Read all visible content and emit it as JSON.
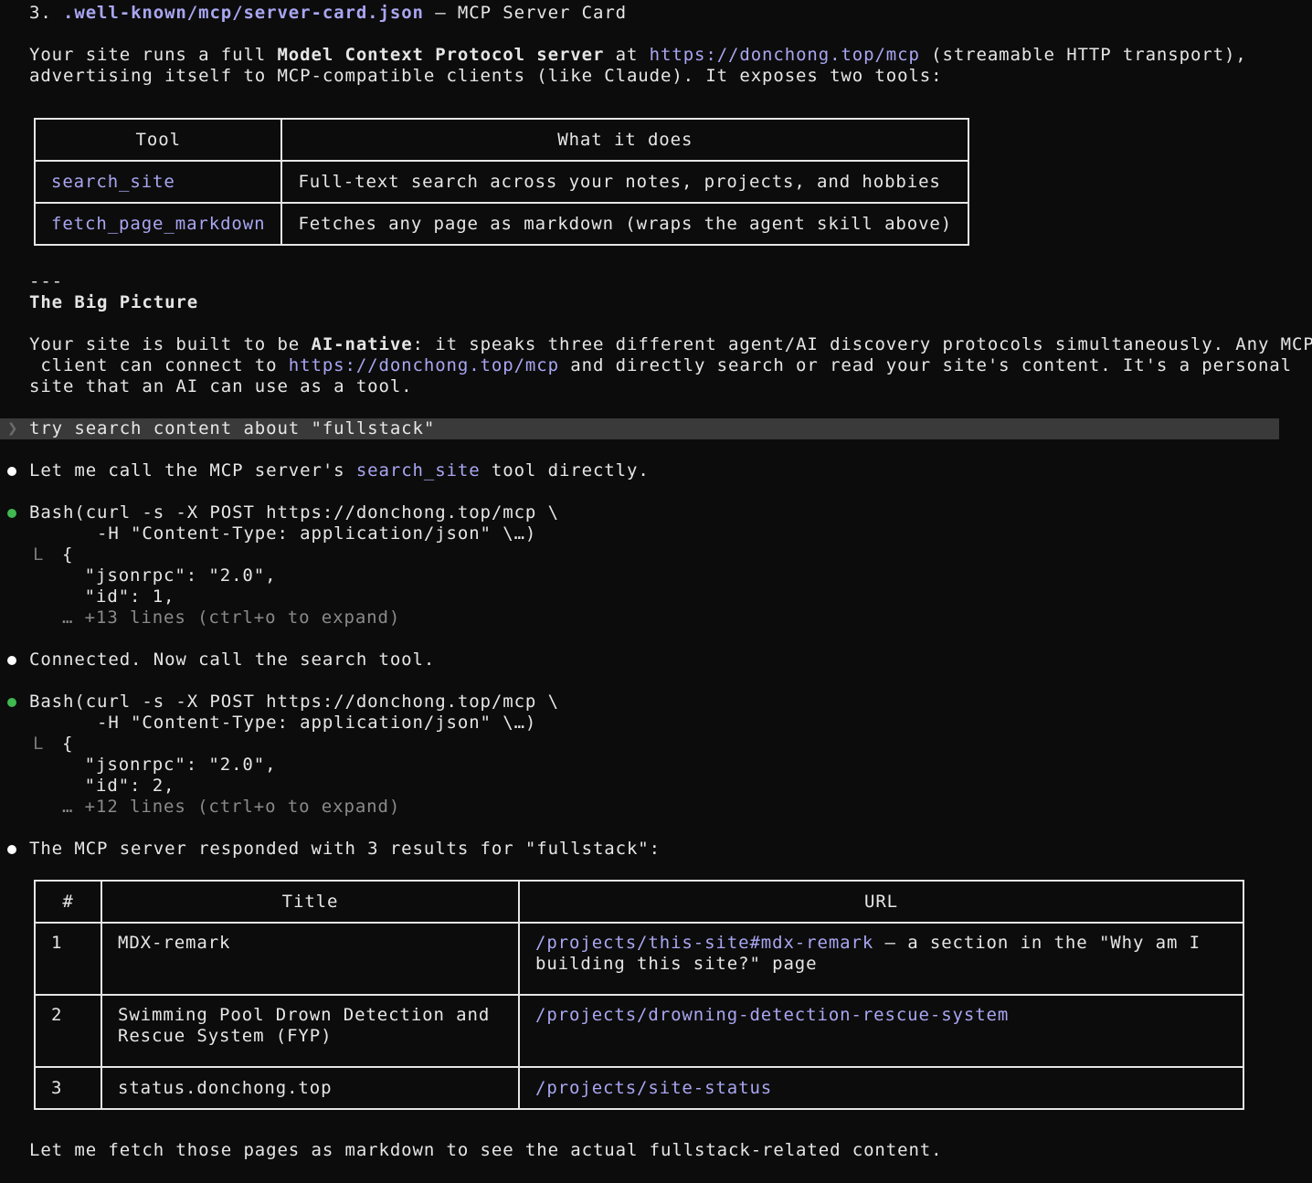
{
  "section3": {
    "num": "3. ",
    "file": ".well-known/mcp/server-card.json",
    "rest": " – MCP Server Card"
  },
  "intro": {
    "p1a": "Your site runs a full ",
    "p1b": "Model Context Protocol server",
    "p1c": " at ",
    "p1link": "https://donchong.top/mcp",
    "p1d": " (streamable HTTP transport),",
    "p2": "advertising itself to MCP-compatible clients (like Claude). It exposes two tools:"
  },
  "tools_table": {
    "headers": [
      "Tool",
      "What it does"
    ],
    "rows": [
      {
        "tool": "search_site",
        "desc": "Full-text search across your notes, projects, and hobbies"
      },
      {
        "tool": "fetch_page_markdown",
        "desc": "Fetches any page as markdown (wraps the agent skill above)"
      }
    ]
  },
  "divider": "---",
  "big_picture": {
    "heading": "The Big Picture",
    "l1a": "Your site is built to be ",
    "l1b": "AI-native",
    "l1c": ": it speaks three different agent/AI discovery protocols simultaneously. Any MCP",
    "l2a": " client can connect to ",
    "l2link": "https://donchong.top/mcp",
    "l2b": " and directly search or read your site's content. It's a personal",
    "l3": "site that an AI can use as a tool."
  },
  "prompt": {
    "chevron": "❯",
    "text": "try search content about \"fullstack\""
  },
  "msg1": {
    "a": "Let me call the MCP server's ",
    "tool": "search_site",
    "b": " tool directly."
  },
  "bash1": {
    "label": "Bash",
    "l1": "(curl -s -X POST https://donchong.top/mcp \\",
    "l2": "      -H \"Content-Type: application/json\" \\…)",
    "tree": "L",
    "o1": "{",
    "o2": "  \"jsonrpc\": \"2.0\",",
    "o3": "  \"id\": 1,",
    "more": "… +13 lines (ctrl+o to expand)"
  },
  "msg2": "Connected. Now call the search tool.",
  "bash2": {
    "label": "Bash",
    "l1": "(curl -s -X POST https://donchong.top/mcp \\",
    "l2": "      -H \"Content-Type: application/json\" \\…)",
    "tree": "L",
    "o1": "{",
    "o2": "  \"jsonrpc\": \"2.0\",",
    "o3": "  \"id\": 2,",
    "more": "… +12 lines (ctrl+o to expand)"
  },
  "msg3": "The MCP server responded with 3 results for \"fullstack\":",
  "results_table": {
    "headers": [
      "#",
      "Title",
      "URL"
    ],
    "rows": [
      {
        "n": "1",
        "title1": "MDX-remark",
        "title2": "",
        "url": "/projects/this-site#mdx-remark",
        "url_rest": " – a section in the \"Why am I",
        "url2": "building this site?\" page"
      },
      {
        "n": "2",
        "title1": "Swimming Pool Drown Detection and",
        "title2": "Rescue System (FYP)",
        "url": "/projects/drowning-detection-rescue-system",
        "url_rest": "",
        "url2": ""
      },
      {
        "n": "3",
        "title1": "status.donchong.top",
        "title2": "",
        "url": "/projects/site-status",
        "url_rest": "",
        "url2": ""
      }
    ]
  },
  "final_msg": "Let me fetch those pages as markdown to see the actual fullstack-related content."
}
